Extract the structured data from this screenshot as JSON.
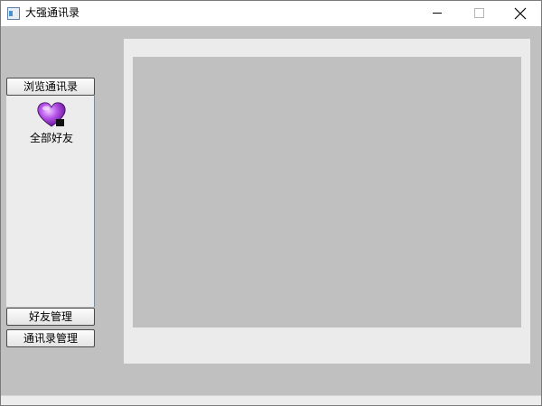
{
  "window": {
    "title": "大强通讯录"
  },
  "toolbox": {
    "pages": [
      {
        "label": "浏览通讯录"
      },
      {
        "label": "好友管理"
      },
      {
        "label": "通讯录管理"
      }
    ],
    "items": [
      {
        "label": "全部好友",
        "icon": "purple-heart-icon"
      }
    ]
  },
  "colors": {
    "window_bg": "#c0c0c0",
    "panel_bg": "#ebebeb",
    "heart": "#9b30d9"
  }
}
